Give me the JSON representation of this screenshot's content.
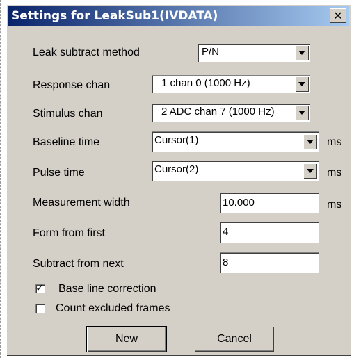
{
  "window": {
    "title": "Settings for LeakSub1(IVDATA)",
    "close_glyph": "✕"
  },
  "fields": {
    "leak_method": {
      "label": "Leak subtract method",
      "value": "P/N"
    },
    "response_chan": {
      "label": "Response chan",
      "value": "1 chan 0 (1000 Hz)"
    },
    "stimulus_chan": {
      "label": "Stimulus chan",
      "value": "2 ADC chan 7 (1000 Hz)"
    },
    "baseline_time": {
      "label": "Baseline time",
      "value": "Cursor(1)",
      "unit": "ms"
    },
    "pulse_time": {
      "label": "Pulse time",
      "value": "Cursor(2)",
      "unit": "ms"
    },
    "measurement_width": {
      "label": "Measurement width",
      "value": "10.000",
      "unit": "ms"
    },
    "form_from_first": {
      "label": "Form from first",
      "value": "4"
    },
    "subtract_from_next": {
      "label": "Subtract from next",
      "value": "8"
    }
  },
  "checkboxes": {
    "baseline_correction": {
      "label": "Base line correction",
      "checked": true,
      "mark": "✓"
    },
    "count_excluded": {
      "label": "Count excluded frames",
      "checked": false,
      "mark": ""
    }
  },
  "buttons": {
    "new": "New",
    "cancel": "Cancel"
  }
}
